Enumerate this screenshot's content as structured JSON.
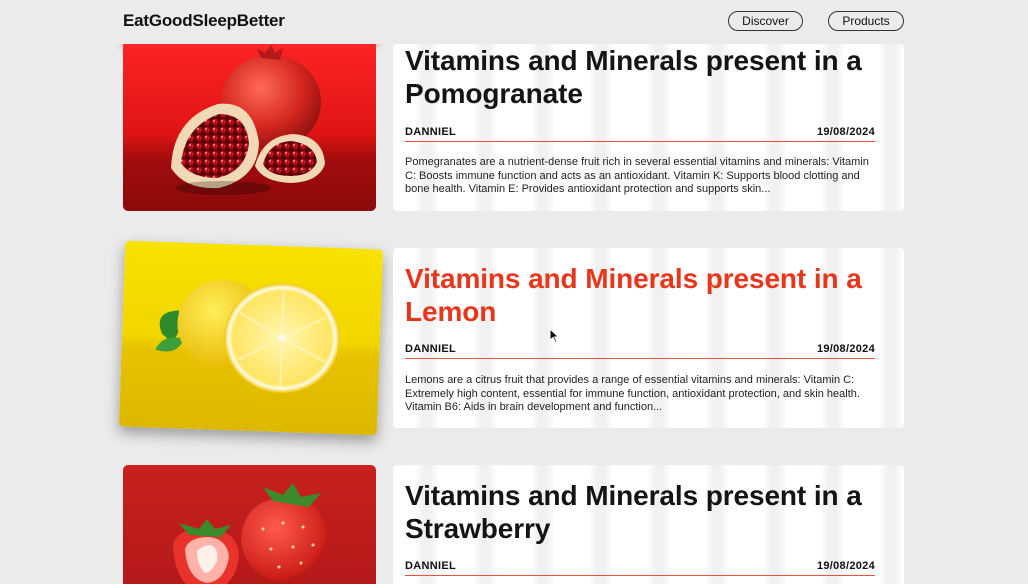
{
  "site": {
    "logo": "EatGoodSleepBetter",
    "nav": [
      "Discover",
      "Products"
    ]
  },
  "posts": [
    {
      "title": "Vitamins and Minerals present in a Pomogranate",
      "author": "DANNIEL",
      "date": "19/08/2024",
      "excerpt": "Pomegranates are a nutrient-dense fruit rich in several essential vitamins and minerals: Vitamin C: Boosts immune function and acts as an antioxidant. Vitamin K: Supports blood clotting and bone health. Vitamin E: Provides antioxidant protection and supports skin...",
      "image_icon": "pomegranate-image",
      "image_bg": "#e11d1d"
    },
    {
      "title": "Vitamins and Minerals present in a Lemon",
      "author": "DANNIEL",
      "date": "19/08/2024",
      "excerpt": "Lemons are a citrus fruit that provides a range of essential vitamins and minerals: Vitamin C: Extremely high content, essential for immune function, antioxidant protection, and skin health. Vitamin B6: Aids in brain development and function...",
      "image_icon": "lemon-image",
      "image_bg": "#f2d700",
      "hover_color": "#e8361c"
    },
    {
      "title": "Vitamins and Minerals present in a Strawberry",
      "author": "DANNIEL",
      "date": "19/08/2024",
      "excerpt": "",
      "image_icon": "strawberry-image",
      "image_bg": "#c8211f"
    }
  ],
  "colors": {
    "background": "#ebebeb",
    "accent": "#e8533a"
  }
}
